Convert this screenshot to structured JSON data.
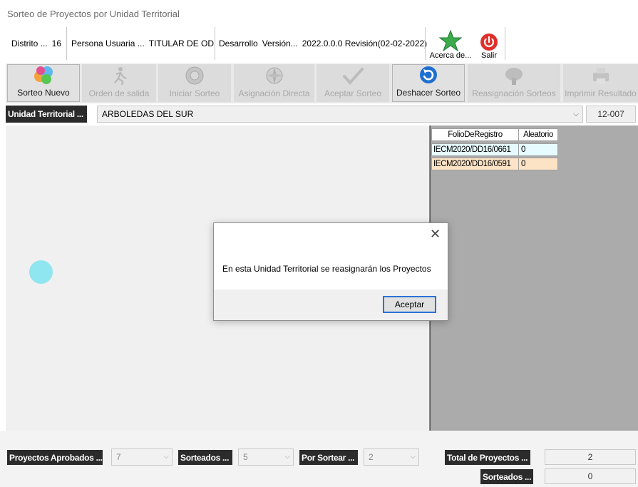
{
  "window": {
    "title": "Sorteo de Proyectos por Unidad Territorial"
  },
  "info": {
    "distrito_label": "Distrito ...",
    "distrito_value": "16",
    "persona_label": "Persona Usuaria ...",
    "persona_value": "TITULAR DE OD",
    "desarrollo_label": "Desarrollo",
    "version_label": "Versión...",
    "version_value": "2022.0.0.0 Revisión(02-02-2022)"
  },
  "about": {
    "label": "Acerca de..."
  },
  "exit": {
    "label": "Salir"
  },
  "toolbar": {
    "sorteo_nuevo": "Sorteo Nuevo",
    "orden_salida": "Orden de salida",
    "iniciar_sorteo": "Iniciar Sorteo",
    "asignacion_directa": "Asignación Directa",
    "aceptar_sorteo": "Aceptar Sorteo",
    "deshacer_sorteo": "Deshacer Sorteo",
    "reasignacion_sorteos": "Reasignación Sorteos",
    "imprimir_resultado": "Imprimir Resultado"
  },
  "territory": {
    "label": "Unidad Territorial ...",
    "selected": "ARBOLEDAS DEL SUR",
    "code": "12-007"
  },
  "grid": {
    "headers": [
      "FolioDeRegistro",
      "Aleatorio"
    ],
    "rows": [
      {
        "folio": "IECM2020/DD16/0661",
        "aleatorio": "0",
        "color": "#e6fbff"
      },
      {
        "folio": "IECM2020/DD16/0591",
        "aleatorio": "0",
        "color": "#fde3c6"
      }
    ]
  },
  "bottom": {
    "aprobados_label": "Proyectos Aprobados ...",
    "aprobados_value": "7",
    "sorteados_label": "Sorteados ...",
    "sorteados_value": "5",
    "por_sortear_label": "Por Sortear ...",
    "por_sortear_value": "2",
    "total_label": "Total de Proyectos ...",
    "total_value": "2",
    "sorteados2_label": "Sorteados ...",
    "sorteados2_value": "0"
  },
  "dialog": {
    "message": "En esta Unidad Territorial se reasignarán los Proyectos",
    "ok_label": "Aceptar",
    "close_glyph": "✕"
  },
  "colors": {
    "dot": "#8fe5f0",
    "exit_red": "#e0302a",
    "accent_blue": "#2b72d6",
    "star_green": "#3bab4e"
  }
}
